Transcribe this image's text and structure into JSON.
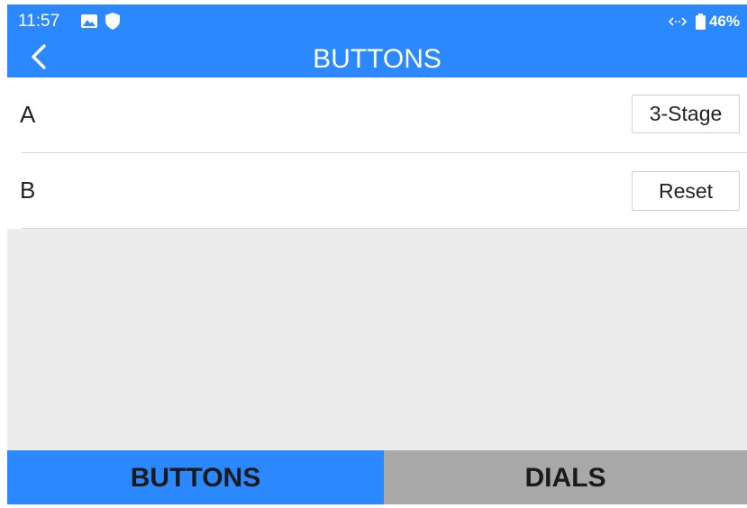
{
  "status_bar": {
    "time": "11:57",
    "battery_percent": "46%",
    "icons": [
      "image-icon",
      "shield-icon",
      "data-arrows-icon",
      "battery-icon"
    ]
  },
  "header": {
    "title": "BUTTONS",
    "back_icon": "chevron-left-icon"
  },
  "rows": [
    {
      "label": "A",
      "button_label": "3-Stage"
    },
    {
      "label": "B",
      "button_label": "Reset"
    }
  ],
  "tabs": [
    {
      "label": "BUTTONS",
      "active": true
    },
    {
      "label": "DIALS",
      "active": false
    }
  ],
  "colors": {
    "accent": "#2b88ff",
    "inactive_tab": "#a8a8a8",
    "empty_area": "#ececec"
  }
}
